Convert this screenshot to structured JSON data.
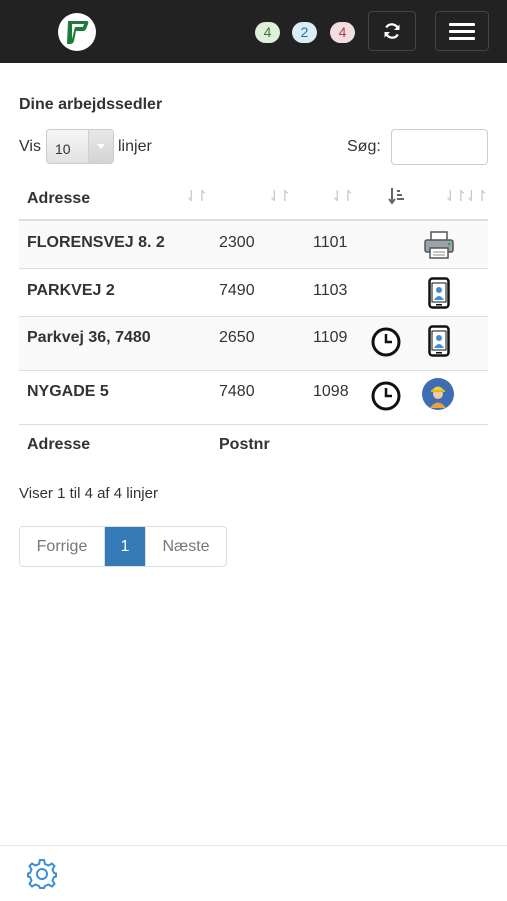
{
  "header": {
    "badges": [
      {
        "value": "4",
        "color": "green"
      },
      {
        "value": "2",
        "color": "blue"
      },
      {
        "value": "4",
        "color": "red"
      }
    ],
    "refresh_icon": "refresh-icon",
    "menu_icon": "hamburger-menu-icon"
  },
  "page": {
    "title": "Dine arbejdssedler",
    "length_prefix": "Vis",
    "length_value": "10",
    "length_suffix": "linjer",
    "search_label": "Søg:",
    "search_value": ""
  },
  "table": {
    "headers": [
      "Adresse",
      "",
      "",
      "",
      ""
    ],
    "rows": [
      {
        "address": "FLORENSVEJ 8. 2",
        "postnr": "2300",
        "nr": "1101",
        "icons": [
          "printer-icon"
        ]
      },
      {
        "address": "PARKVEJ 2",
        "postnr": "7490",
        "nr": "1103",
        "icons": [
          "mobile-phone-icon"
        ]
      },
      {
        "address": "Parkvej 36, 7480",
        "postnr": "2650",
        "nr": "1109",
        "icons": [
          "clock-icon",
          "mobile-phone-icon"
        ]
      },
      {
        "address": "NYGADE 5",
        "postnr": "7480",
        "nr": "1098",
        "icons": [
          "clock-icon",
          "worker-icon"
        ]
      }
    ],
    "footers": [
      "Adresse",
      "Postnr"
    ]
  },
  "info": "Viser 1 til 4 af 4 linjer",
  "pagination": {
    "previous": "Forrige",
    "current": "1",
    "next": "Næste"
  },
  "colors": {
    "navbar": "#222222",
    "primary": "#337ab7"
  }
}
